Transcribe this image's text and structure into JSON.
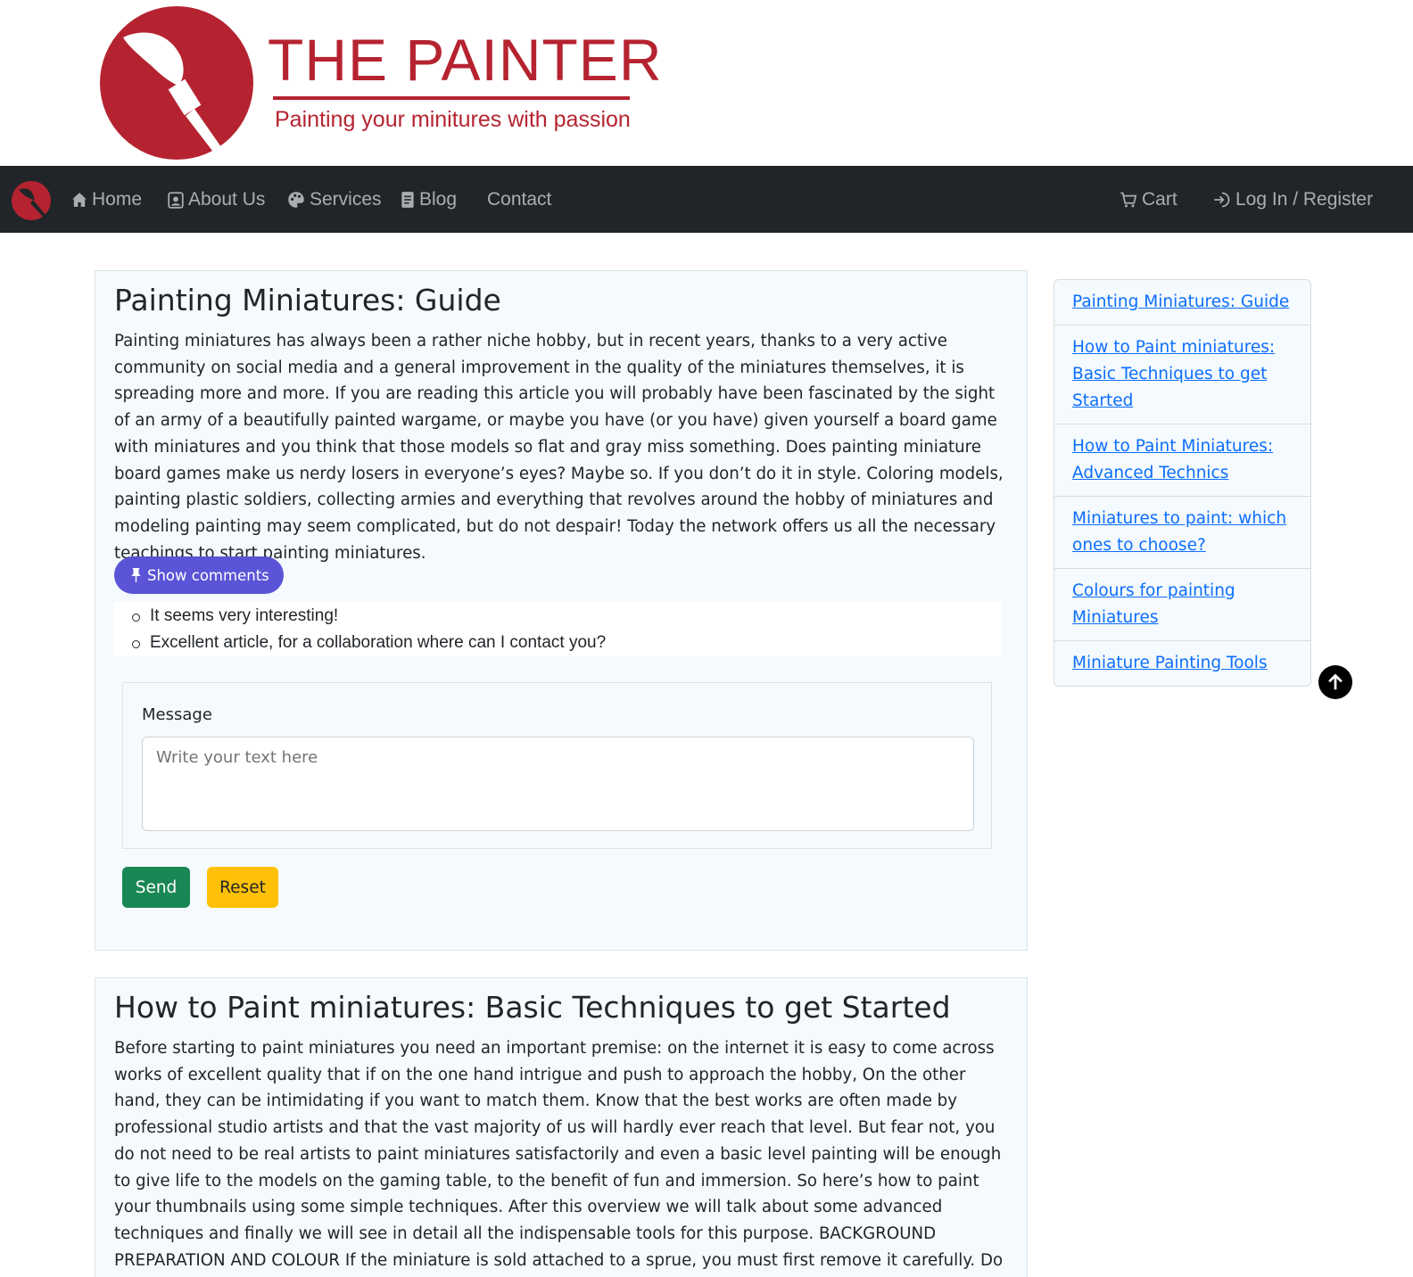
{
  "logo": {
    "title": "THE PAINTER",
    "tagline": "Painting your minitures with passion"
  },
  "nav": {
    "items": [
      {
        "label": "Home",
        "icon": "house-icon"
      },
      {
        "label": "About Us",
        "icon": "person-badge-icon"
      },
      {
        "label": "Services",
        "icon": "palette-icon"
      },
      {
        "label": "Blog",
        "icon": "document-icon"
      },
      {
        "label": "Contact",
        "icon": ""
      }
    ],
    "cart": {
      "label": "Cart",
      "icon": "cart-icon"
    },
    "login": {
      "label": "Log In / Register",
      "icon": "login-icon"
    }
  },
  "articles": [
    {
      "title": "Painting Miniatures: Guide",
      "body": "Painting miniatures has always been a rather niche hobby, but in recent years, thanks to a very active community on social media and a general improvement in the quality of the miniatures themselves, it is spreading more and more. If you are reading this article you will probably have been fascinated by the sight of an army of a beautifully painted wargame, or maybe you have (or you have) given yourself a board game with miniatures and you think that those models so flat and gray miss something. Does painting miniature board games make us nerdy losers in everyone’s eyes? Maybe so. If you don’t do it in style. Coloring models, painting plastic soldiers, collecting armies and everything that revolves around the hobby of miniatures and modeling painting may seem complicated, but do not despair! Today the network offers us all the necessary teachings to start painting miniatures.",
      "show_comments_label": "Show comments",
      "comments": [
        "It seems very interesting!",
        "Excellent article, for a collaboration where can I contact you?"
      ],
      "form": {
        "label": "Message",
        "placeholder": "Write your text here",
        "send_label": "Send",
        "reset_label": "Reset"
      }
    },
    {
      "title": "How to Paint miniatures: Basic Techniques to get Started",
      "body": "Before starting to paint miniatures you need an important premise: on the internet it is easy to come across works of excellent quality that if on the one hand intrigue and push to approach the hobby, On the other hand, they can be intimidating if you want to match them. Know that the best works are often made by professional studio artists and that the vast majority of us will hardly ever reach that level. But fear not, you do not need to be real artists to paint miniatures satisfactorily and even a basic level painting will be enough to give life to the models on the gaming table, to the benefit of fun and immersion. So here’s how to paint your thumbnails using some simple techniques. After this overview we will talk about some advanced techniques and finally we will see in detail all the indispensable tools for this purpose. BACKGROUND PREPARATION AND COLOUR If the miniature is sold attached to a sprue, you must first remove it carefully. Do not underestimate this part and use a cutter or clippers:"
    }
  ],
  "sidebar": {
    "links": [
      "Painting Miniatures: Guide",
      "How to Paint miniatures: Basic Techniques to get Started",
      "How to Paint Miniatures: Advanced Technics",
      "Miniatures to paint: which ones to choose?",
      "Colours for painting Miniatures",
      "Miniature Painting Tools"
    ]
  },
  "colors": {
    "brand_red": "#b52330",
    "navbar_bg": "#212529",
    "primary_purple": "#5a54d6",
    "success_green": "#198754",
    "warning_yellow": "#ffc107",
    "link_blue": "#0d6efd"
  }
}
